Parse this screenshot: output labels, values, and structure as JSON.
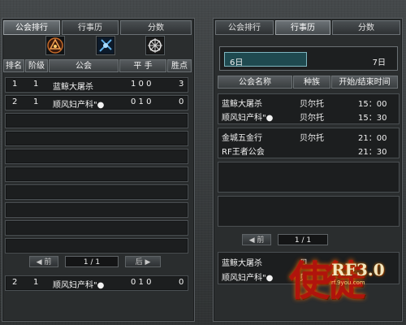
{
  "left": {
    "tabs": [
      {
        "label": "公会排行",
        "active": true
      },
      {
        "label": "行事历",
        "active": false
      },
      {
        "label": "分数",
        "active": false
      }
    ],
    "race_icons": [
      "bellato-race-icon",
      "cora-race-icon",
      "accretia-race-icon"
    ],
    "headers": {
      "rank": "排名",
      "grade": "阶级",
      "guild": "公会",
      "draw": "平 手",
      "win": "胜点"
    },
    "rows": [
      {
        "rank": "1",
        "grade": "1",
        "guild": "蓝鲸大屠杀",
        "draw": "1 0 0",
        "win": "3"
      },
      {
        "rank": "2",
        "grade": "1",
        "guild": "顺风妇产科\"●",
        "draw": "0 1 0",
        "win": "0"
      }
    ],
    "pager": {
      "prev": "前",
      "page": "1 / 1",
      "next": "后"
    },
    "my_guild": {
      "rank": "2",
      "grade": "1",
      "guild": "顺风妇产科\"●",
      "draw": "0 1 0",
      "win": "0"
    }
  },
  "right": {
    "tabs": [
      {
        "label": "公会排行",
        "active": false
      },
      {
        "label": "行事历",
        "active": true
      },
      {
        "label": "分数",
        "active": false
      }
    ],
    "date_start": "6日",
    "date_end": "7日",
    "date_progress": 0.49,
    "headers": {
      "guild": "公会名称",
      "race": "种族",
      "time": "开始/结束时间"
    },
    "schedule": [
      {
        "entries": [
          {
            "guild": "蓝鲸大屠杀",
            "race": "贝尔托",
            "time": "15：00"
          },
          {
            "guild": "顺风妇产科\"●",
            "race": "贝尔托",
            "time": "15：30"
          }
        ]
      },
      {
        "entries": [
          {
            "guild": "金城五金行",
            "race": "贝尔托",
            "time": "21：00"
          },
          {
            "guild": "RF王者公会",
            "race": "",
            "time": "21：30"
          }
        ]
      }
    ],
    "pager": {
      "prev": "前",
      "page": "1 / 1"
    },
    "bottom": [
      {
        "guild": "蓝鲸大屠杀",
        "race": "贝"
      },
      {
        "guild": "顺风妇产科\"●",
        "race": "贝"
      }
    ]
  },
  "logo": {
    "cn": "使徒",
    "en": "RF3.0",
    "site": "rf.9you.com"
  },
  "colors": {
    "panel": "#2a2d2e",
    "row": "#1c1e1f",
    "accent": "#7fb6bf",
    "logo_red": "#b0140c"
  }
}
